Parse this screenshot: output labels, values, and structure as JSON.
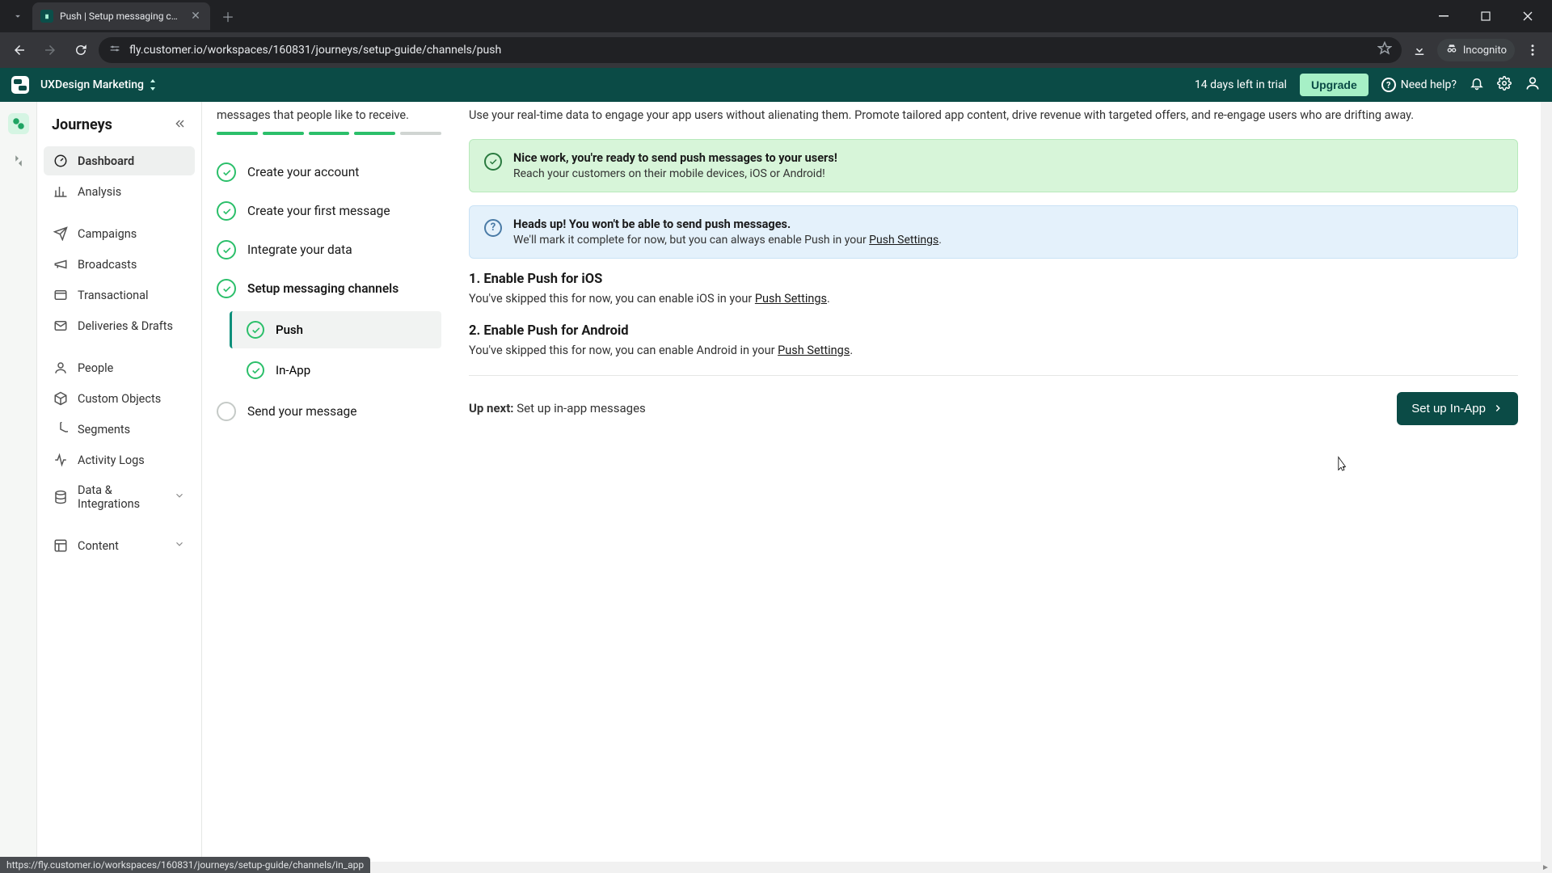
{
  "browser": {
    "tab_title": "Push | Setup messaging chann",
    "url": "fly.customer.io/workspaces/160831/journeys/setup-guide/channels/push",
    "incognito_label": "Incognito"
  },
  "appbar": {
    "workspace": "UXDesign Marketing",
    "trial": "14 days left in trial",
    "upgrade": "Upgrade",
    "help": "Need help?"
  },
  "sidebar": {
    "title": "Journeys",
    "items": {
      "dashboard": "Dashboard",
      "analysis": "Analysis",
      "campaigns": "Campaigns",
      "broadcasts": "Broadcasts",
      "transactional": "Transactional",
      "deliveries": "Deliveries & Drafts",
      "people": "People",
      "custom_objects": "Custom Objects",
      "segments": "Segments",
      "activity_logs": "Activity Logs",
      "data_integrations": "Data & Integrations",
      "content": "Content"
    }
  },
  "steps": {
    "intro": "messages that people like to receive.",
    "create_account": "Create your account",
    "first_message": "Create your first message",
    "integrate": "Integrate your data",
    "setup_channels": "Setup messaging channels",
    "push": "Push",
    "inapp": "In-App",
    "send": "Send your message"
  },
  "main": {
    "intro": "Use your real-time data to engage your app users without alienating them. Promote tailored app content, drive revenue with targeted offers, and re-engage users who are drifting away.",
    "success_title": "Nice work, you're ready to send push messages to your users!",
    "success_text": "Reach your customers on their mobile devices, iOS or Android!",
    "info_title": "Heads up! You won't be able to send push messages.",
    "info_text_a": "We'll mark it complete for now, but you can always enable Push in your ",
    "info_link": "Push Settings",
    "s1_title": "1. Enable Push for iOS",
    "s1_text_a": "You've skipped this for now, you can enable iOS in your ",
    "s1_link": "Push Settings",
    "s2_title": "2. Enable Push for Android",
    "s2_text_a": "You've skipped this for now, you can enable Android in your ",
    "s2_link": "Push Settings",
    "upnext_label": "Up next:",
    "upnext_text": " Set up in-app messages",
    "cta": "Set up In-App"
  },
  "status_url": "https://fly.customer.io/workspaces/160831/journeys/setup-guide/channels/in_app"
}
